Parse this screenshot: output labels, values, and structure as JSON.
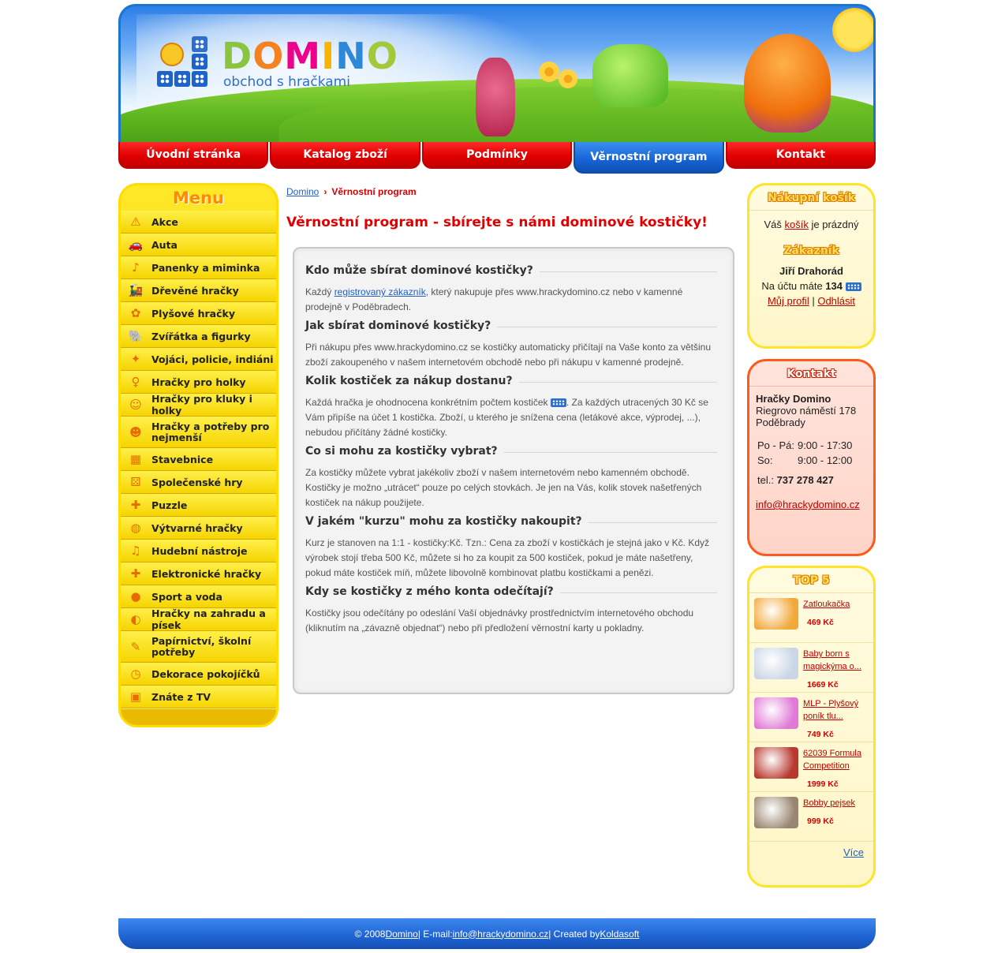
{
  "header": {
    "logo_title_letters": [
      "D",
      "O",
      "M",
      "I",
      "N",
      "O"
    ],
    "logo_subtitle": "obchod s hračkami"
  },
  "nav": [
    {
      "label": "Úvodní stránka",
      "active": false
    },
    {
      "label": "Katalog zboží",
      "active": false
    },
    {
      "label": "Podmínky",
      "active": false
    },
    {
      "label": "Věrnostní program",
      "active": true
    },
    {
      "label": "Kontakt",
      "active": false
    }
  ],
  "menu": {
    "title": "Menu",
    "items": [
      {
        "label": "Akce",
        "icon": "warning-icon"
      },
      {
        "label": "Auta",
        "icon": "car-icon"
      },
      {
        "label": "Panenky a miminka",
        "icon": "rattle-icon"
      },
      {
        "label": "Dřevěné hračky",
        "icon": "wooden-train-icon"
      },
      {
        "label": "Plyšové hračky",
        "icon": "plush-icon"
      },
      {
        "label": "Zvířátka a figurky",
        "icon": "elephant-icon"
      },
      {
        "label": "Vojáci, policie, indiáni",
        "icon": "gun-icon"
      },
      {
        "label": "Hračky pro holky",
        "icon": "girl-icon"
      },
      {
        "label": "Hračky pro kluky i holky",
        "icon": "kids-icon"
      },
      {
        "label": "Hračky a potřeby pro nejmenší",
        "icon": "baby-icon"
      },
      {
        "label": "Stavebnice",
        "icon": "blocks-icon"
      },
      {
        "label": "Společenské hry",
        "icon": "dice-icon"
      },
      {
        "label": "Puzzle",
        "icon": "puzzle-icon"
      },
      {
        "label": "Výtvarné hračky",
        "icon": "palette-icon"
      },
      {
        "label": "Hudební nástroje",
        "icon": "music-icon"
      },
      {
        "label": "Elektronické hračky",
        "icon": "plus-icon"
      },
      {
        "label": "Sport a voda",
        "icon": "ball-icon"
      },
      {
        "label": "Hračky na zahradu a písek",
        "icon": "bucket-icon"
      },
      {
        "label": "Papírnictví, školní potřeby",
        "icon": "pencil-icon"
      },
      {
        "label": "Dekorace pokojíčků",
        "icon": "clock-icon"
      },
      {
        "label": "Znáte z TV",
        "icon": "tv-icon"
      }
    ]
  },
  "breadcrumb": {
    "home": "Domino",
    "current": "Věrnostní program"
  },
  "page_title": "Věrnostní program - sbírejte s námi dominové kostičky!",
  "sections": [
    {
      "heading": "Kdo může sbírat dominové kostičky?",
      "text_before": "Každý ",
      "link": "registrovaný zákazník",
      "text_after": ", který nakupuje přes www.hrackydomino.cz nebo v kamenné prodejně v Poděbradech."
    },
    {
      "heading": "Jak sbírat dominové kostičky?",
      "text": "Při nákupu přes www.hrackydomino.cz se kostičky automaticky přičítají na Vaše konto za většinu zboží zakoupeného v našem internetovém obchodě nebo při nákupu v kamenné prodejně."
    },
    {
      "heading": "Kolik kostiček za nákup dostanu?",
      "text_before": "Každá hračka je ohodnocena konkrétním počtem kostiček ",
      "text_after": ". Za každých utracených 30 Kč se Vám připíše na účet 1 kostička. Zboží, u kterého je snížena cena (letákové akce, výprodej, ...), nebudou přičítány žádné kostičky."
    },
    {
      "heading": "Co si mohu za kostičky vybrat?",
      "text": "Za kostičky můžete vybrat jakékoliv zboží v našem internetovém nebo kamenném obchodě. Kostičky je možno „utrácet“ pouze po celých stovkách. Je jen na Vás, kolik stovek našetřených kostiček na nákup použijete."
    },
    {
      "heading": "V jakém \"kurzu\" mohu za kostičky nakoupit?",
      "text": "Kurz je stanoven na 1:1 - kostičky:Kč. Tzn.: Cena za zboží v kostičkách je stejná jako v Kč. Když výrobek stojí třeba 500 Kč, můžete si ho za koupit za 500 kostiček, pokud je máte našetřeny, pokud máte kostiček míň, můžete libovolně kombinovat platbu kostičkami a penězi."
    },
    {
      "heading": "Kdy se kostičky z mého konta odečítají?",
      "text": "Kostičky jsou odečítány po odeslání Vaší objednávky prostřednictvím internetového obchodu (kliknutím na „závazně objednat“) nebo při předložení věrnostní karty u pokladny."
    }
  ],
  "cart": {
    "title": "Nákupní košík",
    "text_before": "Váš ",
    "link": "košík",
    "text_after": " je prázdný",
    "customer_title": "Zákazník",
    "customer_name": "Jiří Drahorád",
    "balance_label": "Na účtu máte ",
    "balance_value": "134",
    "profile_link": "Můj profil",
    "separator": " | ",
    "logout_link": "Odhlásit"
  },
  "contact": {
    "title": "Kontakt",
    "name": "Hračky Domino",
    "street": "Riegrovo náměstí 178",
    "city": "Poděbrady",
    "hours": [
      {
        "day": "Po - Pá:",
        "time": "9:00 - 17:30"
      },
      {
        "day": "So:",
        "time": "9:00 - 12:00"
      }
    ],
    "tel_label": "tel.: ",
    "tel": "737 278 427",
    "email": "info@hrackydomino.cz"
  },
  "top5": {
    "title": "TOP 5",
    "items": [
      {
        "name": "Zatloukačka",
        "price": "469 Kč",
        "color": "#f2a93b"
      },
      {
        "name": "Baby born s magickýma o...",
        "price": "1669 Kč",
        "color": "#c9d6e6"
      },
      {
        "name": "MLP - Plyšový poník tlu...",
        "price": "749 Kč",
        "color": "#e07ad6"
      },
      {
        "name": "62039 Formula Competition",
        "price": "1999 Kč",
        "color": "#b8392f"
      },
      {
        "name": "Bobby pejsek",
        "price": "999 Kč",
        "color": "#9a8670"
      }
    ],
    "more": "Více"
  },
  "footer": {
    "copyright": "© 2008 ",
    "site_link": "Domino",
    "email_label": " | E-mail: ",
    "email": "info@hrackydomino.cz",
    "created_label": " | Created by ",
    "author": "Koldasoft"
  },
  "colors": {
    "accent_red": "#e00000",
    "accent_blue": "#1f63d2",
    "menu_yellow": "#f8d200"
  }
}
